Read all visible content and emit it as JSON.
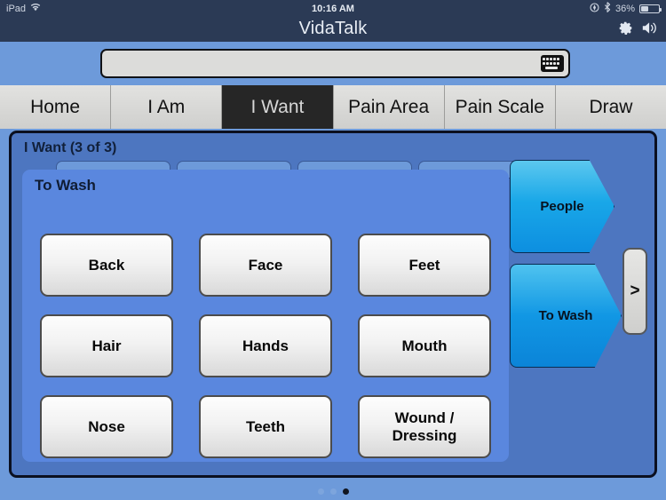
{
  "status_bar": {
    "device": "iPad",
    "wifi_icon": "wifi-icon",
    "time": "10:16 AM",
    "location_icon": "location-services-icon",
    "bluetooth_icon": "bluetooth-icon",
    "battery_percent": "36%",
    "battery_icon": "battery-icon"
  },
  "title_bar": {
    "app_title": "VidaTalk",
    "settings_icon": "gear-icon",
    "volume_icon": "speaker-volume-icon",
    "background_color": "#2b3a55"
  },
  "search": {
    "value": "",
    "placeholder": "",
    "keyboard_icon": "keyboard-icon"
  },
  "tabs": [
    {
      "label": "Home",
      "active": false
    },
    {
      "label": "I Am",
      "active": false
    },
    {
      "label": "I Want",
      "active": true
    },
    {
      "label": "Pain Area",
      "active": false
    },
    {
      "label": "Pain Scale",
      "active": false
    },
    {
      "label": "Draw",
      "active": false
    }
  ],
  "content": {
    "section_title": "I Want (3 of 3)",
    "page_label": "To Wash",
    "buttons": [
      "Back",
      "Face",
      "Feet",
      "Hair",
      "Hands",
      "Mouth",
      "Nose",
      "Teeth",
      "Wound /\nDressing"
    ]
  },
  "category_tabs": [
    {
      "label": "People",
      "selected": false
    },
    {
      "label": "To Wash",
      "selected": true
    }
  ],
  "next_button": {
    "label": ">"
  },
  "pager": {
    "total": 3,
    "current": 3
  },
  "colors": {
    "chrome": "#2b3a55",
    "page_background": "#6d9ada",
    "panel_outer": "#4d76c0",
    "panel_inner": "#5a87de",
    "active_tab": "#262626",
    "category_accent": "#19a7e8"
  }
}
